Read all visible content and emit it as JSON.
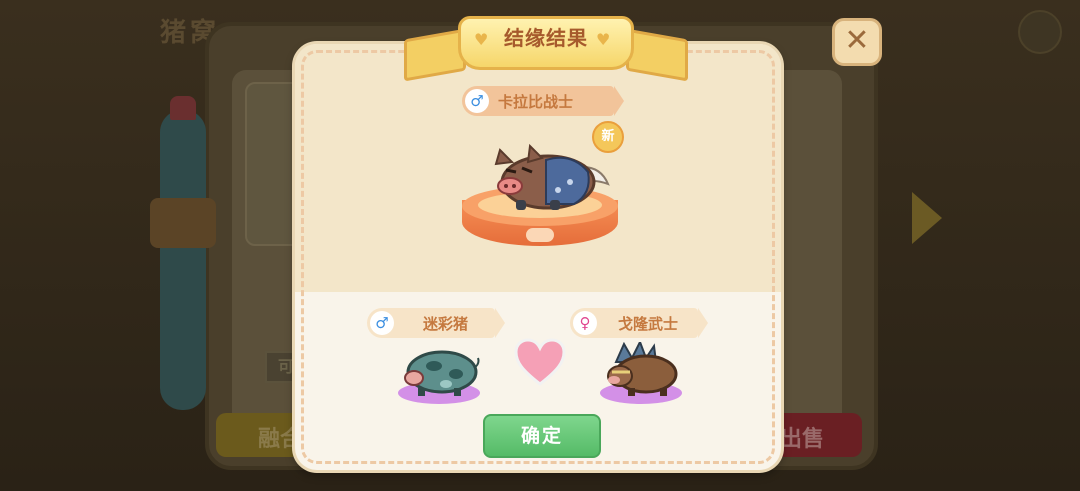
{
  "background": {
    "title": "猪窝",
    "left_button_label": "融合",
    "right_button_label": "出售",
    "can_label": "可"
  },
  "dialog": {
    "title": "结缘结果",
    "result": {
      "name": "卡拉比战士",
      "gender": "male",
      "new_badge": "新"
    },
    "parent_left": {
      "name": "迷彩猪",
      "gender": "male"
    },
    "parent_right": {
      "name": "戈隆武士",
      "gender": "female"
    },
    "confirm_label": "确定"
  },
  "icons": {
    "close": "close-icon",
    "male": "male-gender-icon",
    "female": "female-gender-icon",
    "heart": "heart-icon"
  },
  "colors": {
    "confirm_green": "#5cc26d",
    "ribbon_gold": "#f6d66a",
    "pedestal_orange": "#f68f55",
    "male_blue": "#3a8ee0",
    "female_pink": "#e0478f"
  }
}
